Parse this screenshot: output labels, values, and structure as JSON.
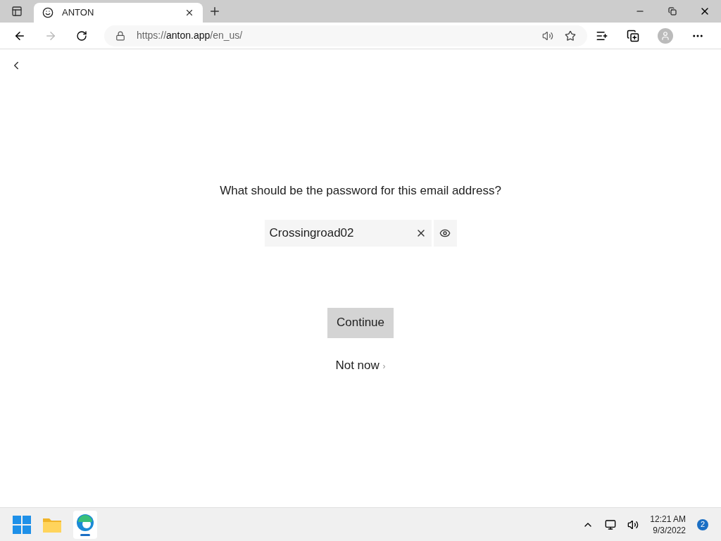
{
  "browser": {
    "tab": {
      "title": "ANTON"
    },
    "url": {
      "scheme": "https://",
      "host": "anton.app",
      "path": "/en_us/"
    }
  },
  "page": {
    "question": "What should be the password for this email address?",
    "password": {
      "value": "Crossingroad02"
    },
    "continue_button": "Continue",
    "skip_link": "Not now",
    "skip_chevron": "›"
  },
  "taskbar": {
    "time": "12:21 AM",
    "date": "9/3/2022",
    "notifications": "2"
  }
}
